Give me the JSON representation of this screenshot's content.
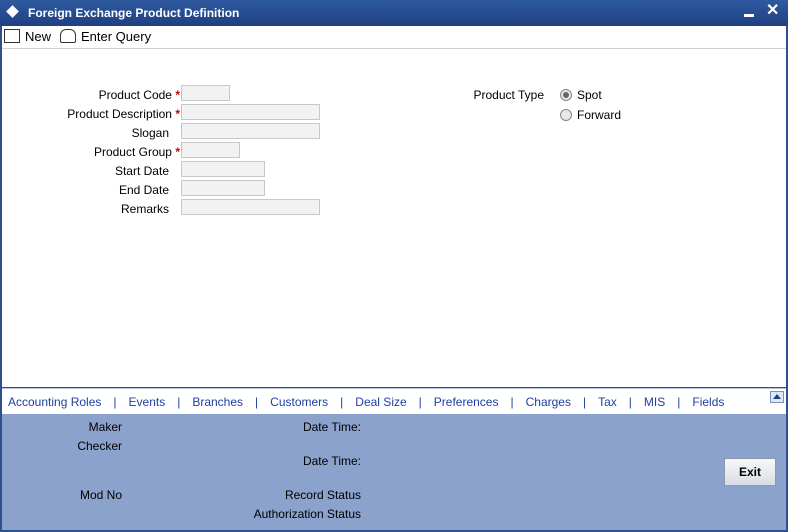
{
  "window": {
    "title": "Foreign Exchange Product Definition",
    "minimize": "▬",
    "close": "✕"
  },
  "toolbar": {
    "new_label": "New",
    "enter_query_label": "Enter Query"
  },
  "form": {
    "product_code_label": "Product Code",
    "product_description_label": "Product Description",
    "slogan_label": "Slogan",
    "product_group_label": "Product Group",
    "start_date_label": "Start Date",
    "end_date_label": "End Date",
    "remarks_label": "Remarks",
    "required_mark": "*",
    "product_type_label": "Product Type",
    "product_type_options": [
      "Spot",
      "Forward"
    ]
  },
  "tabs": [
    "Accounting Roles",
    "Events",
    "Branches",
    "Customers",
    "Deal Size",
    "Preferences",
    "Charges",
    "Tax",
    "MIS",
    "Fields"
  ],
  "tab_separator": "|",
  "footer": {
    "maker_label": "Maker",
    "checker_label": "Checker",
    "date_time_label": "Date Time:",
    "mod_no_label": "Mod No",
    "record_status_label": "Record Status",
    "authorization_status_label": "Authorization Status",
    "exit_label": "Exit"
  }
}
